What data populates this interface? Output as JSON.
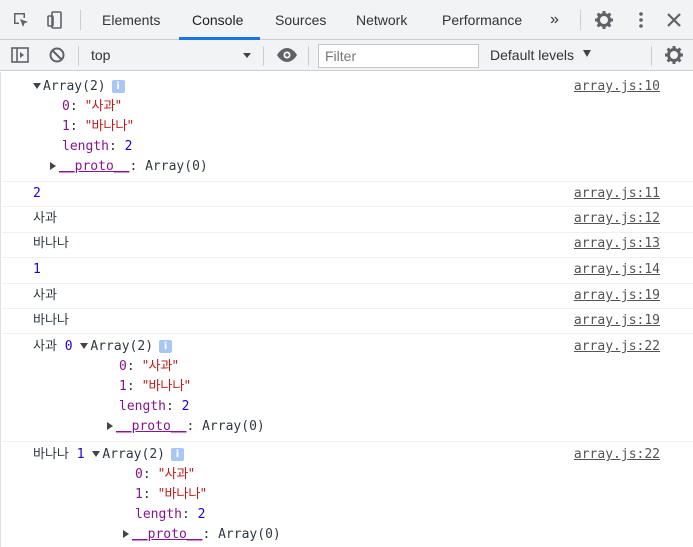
{
  "tabbar": {
    "tabs": [
      {
        "label": "Elements"
      },
      {
        "label": "Console"
      },
      {
        "label": "Sources"
      },
      {
        "label": "Network"
      },
      {
        "label": "Performance"
      }
    ],
    "more": "»"
  },
  "toolbar": {
    "context": "top",
    "filter_placeholder": "Filter",
    "levels": "Default levels"
  },
  "obj": {
    "header": "Array(2)",
    "info": "i",
    "k0": "0",
    "v0": "\"사과\"",
    "k1": "1",
    "v1": "\"바나나\"",
    "klen": "length",
    "vlen": "2",
    "proto_key": "__proto__",
    "proto_val": "Array(0)",
    "colon": ": "
  },
  "messages": [
    {
      "source": "array.js:10"
    },
    {
      "text": "2",
      "source": "array.js:11"
    },
    {
      "text": "사과",
      "source": "array.js:12"
    },
    {
      "text": "바나나",
      "source": "array.js:13"
    },
    {
      "text": "1",
      "source": "array.js:14"
    },
    {
      "text": "사과",
      "source": "array.js:19"
    },
    {
      "text": "바나나",
      "source": "array.js:19"
    },
    {
      "prefix": "사과",
      "index": "0",
      "source": "array.js:22"
    },
    {
      "prefix": "바나나",
      "index": "1",
      "source": "array.js:22"
    }
  ]
}
